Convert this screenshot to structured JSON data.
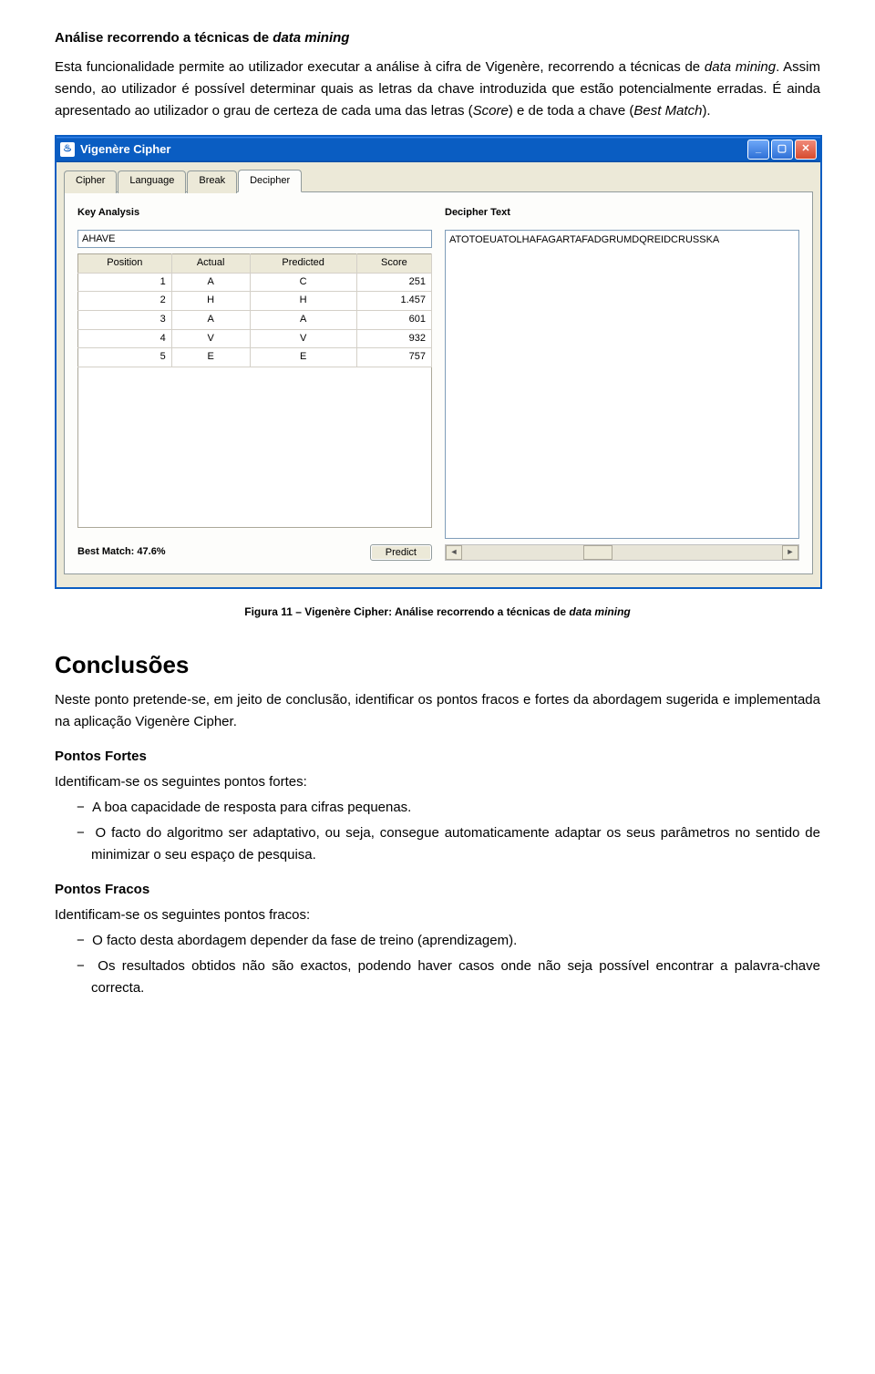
{
  "doc": {
    "h_analysis_pre": "Análise recorrendo a técnicas de ",
    "h_analysis_em": "data mining",
    "p1_a": "Esta funcionalidade permite ao utilizador executar a análise à cifra de Vigenère, recorrendo a técnicas de ",
    "p1_em": "data mining",
    "p1_b": ". Assim sendo, ao utilizador é possível determinar quais as letras da chave introduzida que estão potencialmente erradas. É ainda apresentado ao utilizador o grau de certeza de cada uma das letras (",
    "p1_c_em": "Score",
    "p1_d": ") e de toda a chave (",
    "p1_e_em": "Best Match",
    "p1_f": ").",
    "caption_pre": "Figura 11 – Vigenère Cipher: Análise recorrendo a técnicas de ",
    "caption_em": "data mining",
    "h_conclusions": "Conclusões",
    "p2": "Neste ponto pretende-se, em jeito de conclusão, identificar os pontos fracos e fortes da abordagem sugerida e implementada na aplicação Vigenère Cipher.",
    "h_fortes": "Pontos Fortes",
    "p_fortes_intro": "Identificam-se os seguintes pontos fortes:",
    "fortes": [
      "A boa capacidade de resposta para cifras pequenas.",
      "O facto do algoritmo ser adaptativo, ou seja, consegue automaticamente adaptar os seus parâmetros no sentido de minimizar o seu espaço de pesquisa."
    ],
    "h_fracos": "Pontos Fracos",
    "p_fracos_intro": "Identificam-se os seguintes pontos fracos:",
    "fracos": [
      "O facto desta abordagem depender da fase de treino (aprendizagem).",
      "Os resultados obtidos não são exactos, podendo haver casos onde não seja possível encontrar a palavra-chave correcta."
    ]
  },
  "app": {
    "title": "Vigenère Cipher",
    "tabs": [
      "Cipher",
      "Language",
      "Break",
      "Decipher"
    ],
    "left_label": "Key Analysis",
    "right_label": "Decipher Text",
    "key_input": "AHAVE",
    "table_headers": [
      "Position",
      "Actual",
      "Predicted",
      "Score"
    ],
    "rows": [
      {
        "pos": "1",
        "actual": "A",
        "pred": "C",
        "score": "251"
      },
      {
        "pos": "2",
        "actual": "H",
        "pred": "H",
        "score": "1.457"
      },
      {
        "pos": "3",
        "actual": "A",
        "pred": "A",
        "score": "601"
      },
      {
        "pos": "4",
        "actual": "V",
        "pred": "V",
        "score": "932"
      },
      {
        "pos": "5",
        "actual": "E",
        "pred": "E",
        "score": "757"
      }
    ],
    "best_match": "Best Match: 47.6%",
    "predict_label": "Predict",
    "decipher_text": "ATOTOEUATOLHAFAGARTAFADGRUMDQREIDCRUSSKA"
  }
}
